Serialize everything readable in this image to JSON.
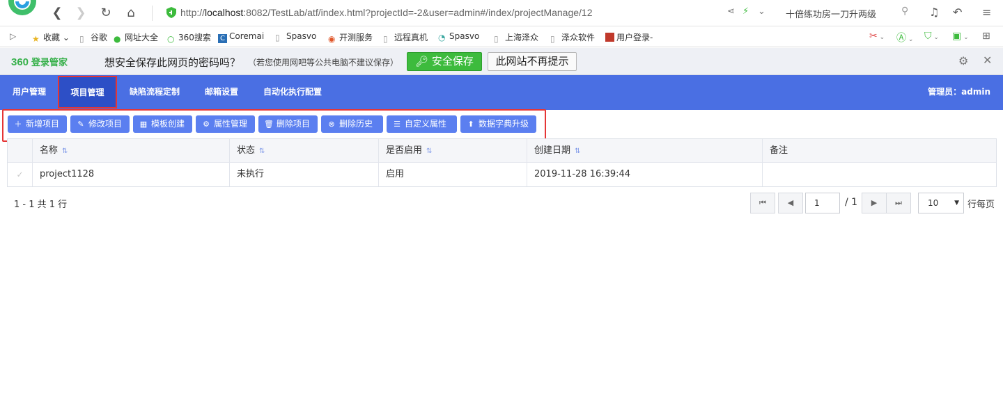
{
  "browser": {
    "url_prefix": "http://",
    "url_host": "localhost",
    "url_rest": ":8082/TestLab/atf/index.html?projectId=-2&user=admin#/index/projectManage/12",
    "hot_search": "十倍练功房一刀升两级"
  },
  "bookmarks": [
    {
      "label": "收藏",
      "icon": "star-icon"
    },
    {
      "label": "谷歌",
      "icon": "page-icon"
    },
    {
      "label": "网址大全",
      "icon": "globe-icon"
    },
    {
      "label": "360搜索",
      "icon": "search-360-icon"
    },
    {
      "label": "Coremai",
      "icon": "c-icon"
    },
    {
      "label": "Spasvo",
      "icon": "page-icon"
    },
    {
      "label": "开测服务",
      "icon": "target-icon"
    },
    {
      "label": "远程真机",
      "icon": "page-icon"
    },
    {
      "label": "Spasvo",
      "icon": "swirl-icon"
    },
    {
      "label": "上海泽众",
      "icon": "page-icon"
    },
    {
      "label": "泽众软件",
      "icon": "page-icon"
    },
    {
      "label": "用户登录-",
      "icon": "app-icon"
    }
  ],
  "password_bar": {
    "brand": "360",
    "brand_sub": "登录管家",
    "question": "想安全保存此网页的密码吗？",
    "note": "（若您使用网吧等公共电脑不建议保存）",
    "save_label": "安全保存",
    "never_label": "此网站不再提示"
  },
  "nav": {
    "items": [
      "用户管理",
      "项目管理",
      "缺陷流程定制",
      "邮箱设置",
      "自动化执行配置"
    ],
    "active": "项目管理",
    "admin": "管理员：admin"
  },
  "toolbar": [
    {
      "label": "新增项目",
      "icon": "plus-icon"
    },
    {
      "label": "修改项目",
      "icon": "edit-icon"
    },
    {
      "label": "模板创建",
      "icon": "template-icon"
    },
    {
      "label": "属性管理",
      "icon": "settings-icon"
    },
    {
      "label": "删除项目",
      "icon": "trash-icon"
    },
    {
      "label": "删除历史",
      "icon": "remove-circle-icon"
    },
    {
      "label": "自定义属性",
      "icon": "custom-attr-icon"
    },
    {
      "label": "数据字典升级",
      "icon": "upload-icon"
    }
  ],
  "grid": {
    "columns": [
      "名称",
      "状态",
      "是否启用",
      "创建日期",
      "备注"
    ],
    "rows": [
      {
        "name": "project1128",
        "status": "未执行",
        "enabled": "启用",
        "created": "2019-11-28 16:39:44",
        "remark": ""
      }
    ]
  },
  "pager": {
    "summary": "1 - 1 共 1 行",
    "page": "1",
    "total": "/ 1",
    "page_size": "10",
    "per_page_label": "行每页"
  },
  "colors": {
    "nav_bg": "#4a6fe3",
    "nav_active": "#2d4fc6",
    "button": "#5b7ff0",
    "highlight_border": "#e53535",
    "save_green": "#3dbb3d"
  }
}
